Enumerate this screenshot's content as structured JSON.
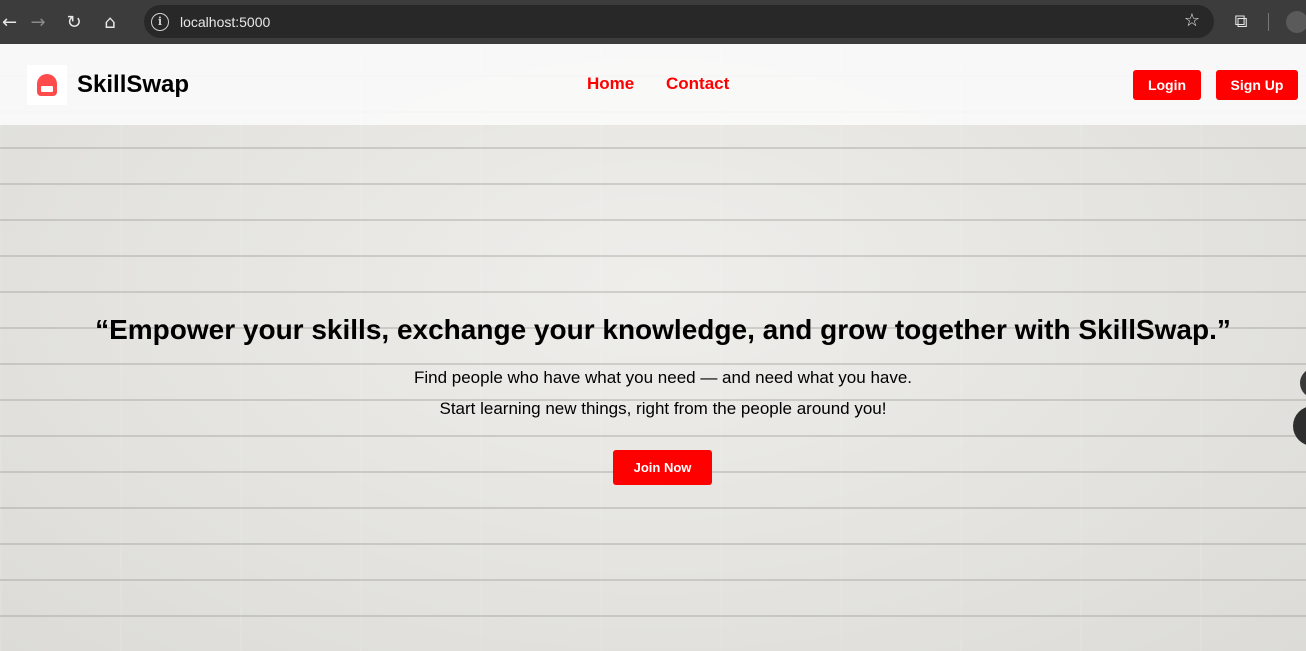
{
  "browser": {
    "url": "localhost:5000",
    "back_icon": "arrow-left-icon",
    "forward_icon": "arrow-right-icon",
    "reload_icon": "reload-icon",
    "home_icon": "home-icon",
    "info_icon": "info-icon",
    "bookmark_icon": "star-icon",
    "extensions_icon": "puzzle-icon"
  },
  "navbar": {
    "brand": "SkillSwap",
    "links": {
      "home": "Home",
      "contact": "Contact"
    },
    "login_label": "Login",
    "signup_label": "Sign Up"
  },
  "hero": {
    "quote": "“Empower your skills, exchange your knowledge, and grow together with SkillSwap.”",
    "line1": "Find people who have what you need — and need what you have.",
    "line2": "Start learning new things, right from the people around you!",
    "cta_label": "Join Now"
  },
  "colors": {
    "accent": "#ff0000",
    "chrome_bg": "#3c3c3c",
    "omnibox_bg": "#282828"
  }
}
